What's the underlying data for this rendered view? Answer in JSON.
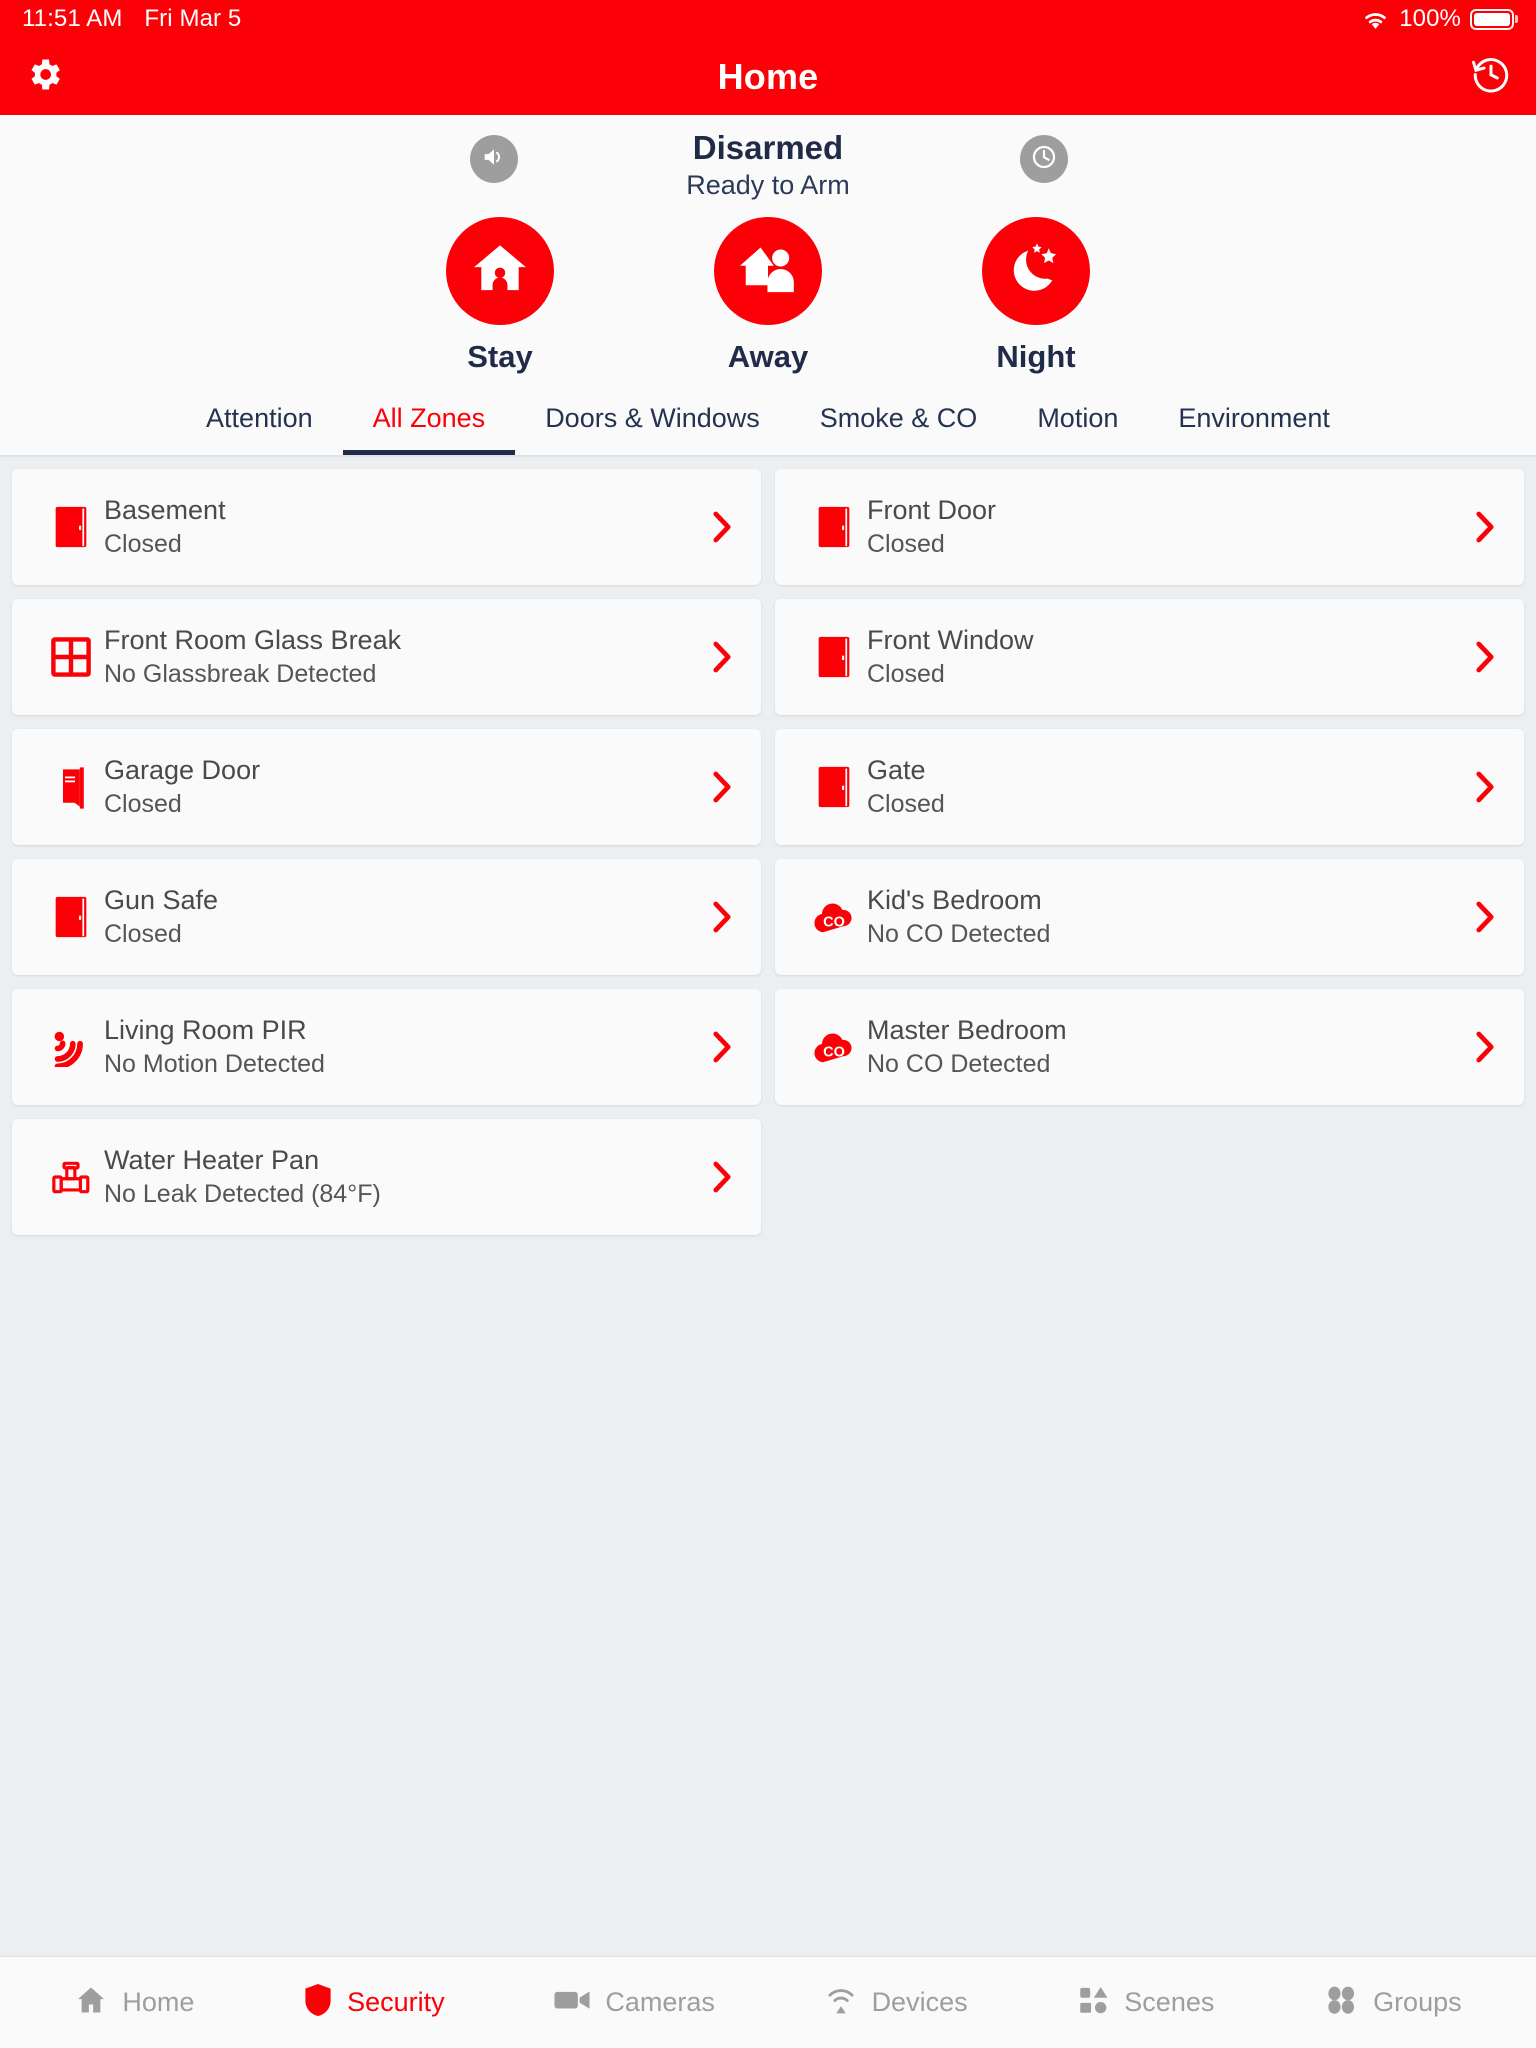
{
  "statusbar": {
    "time": "11:51 AM",
    "date": "Fri Mar 5",
    "battery_percent": "100%",
    "wifi_icon": "wifi-icon",
    "battery_icon": "battery-icon"
  },
  "navbar": {
    "title": "Home",
    "settings_icon": "gear-icon",
    "history_icon": "history-clock-icon"
  },
  "arm_panel": {
    "status_main": "Disarmed",
    "status_sub": "Ready to Arm",
    "speaker_icon": "speaker-icon",
    "timer_icon": "clock-icon",
    "buttons": [
      {
        "label": "Stay",
        "icon": "house-person-icon"
      },
      {
        "label": "Away",
        "icon": "house-walking-person-icon"
      },
      {
        "label": "Night",
        "icon": "moon-stars-icon"
      }
    ]
  },
  "tabs": [
    {
      "label": "Attention",
      "active": false
    },
    {
      "label": "All Zones",
      "active": true
    },
    {
      "label": "Doors & Windows",
      "active": false
    },
    {
      "label": "Smoke & CO",
      "active": false
    },
    {
      "label": "Motion",
      "active": false
    },
    {
      "label": "Environment",
      "active": false
    }
  ],
  "zones": [
    {
      "name": "Basement",
      "state": "Closed",
      "icon": "door-icon"
    },
    {
      "name": "Front Door",
      "state": "Closed",
      "icon": "door-icon"
    },
    {
      "name": "Front Room Glass Break",
      "state": "No Glassbreak Detected",
      "icon": "window-icon"
    },
    {
      "name": "Front Window",
      "state": "Closed",
      "icon": "door-icon"
    },
    {
      "name": "Garage Door",
      "state": "Closed",
      "icon": "garage-door-icon"
    },
    {
      "name": "Gate",
      "state": "Closed",
      "icon": "door-icon"
    },
    {
      "name": "Gun Safe",
      "state": "Closed",
      "icon": "door-icon"
    },
    {
      "name": "Kid's Bedroom",
      "state": "No CO Detected",
      "icon": "co-icon"
    },
    {
      "name": "Living Room PIR",
      "state": "No Motion Detected",
      "icon": "motion-icon"
    },
    {
      "name": "Master Bedroom",
      "state": "No CO Detected",
      "icon": "co-icon"
    },
    {
      "name": "Water Heater Pan",
      "state": "No Leak Detected (84°F)",
      "icon": "water-pipe-icon"
    }
  ],
  "bottom_nav": [
    {
      "label": "Home",
      "icon": "house-icon",
      "active": false
    },
    {
      "label": "Security",
      "icon": "shield-icon",
      "active": true
    },
    {
      "label": "Cameras",
      "icon": "camera-icon",
      "active": false
    },
    {
      "label": "Devices",
      "icon": "devices-icon",
      "active": false
    },
    {
      "label": "Scenes",
      "icon": "scenes-icon",
      "active": false
    },
    {
      "label": "Groups",
      "icon": "groups-icon",
      "active": false
    }
  ],
  "colors": {
    "brand_red": "#fb0007",
    "navy": "#1f2b47",
    "gray": "#9e9e9e",
    "page_bg": "#eceff1",
    "card_bg": "#fafafa"
  }
}
